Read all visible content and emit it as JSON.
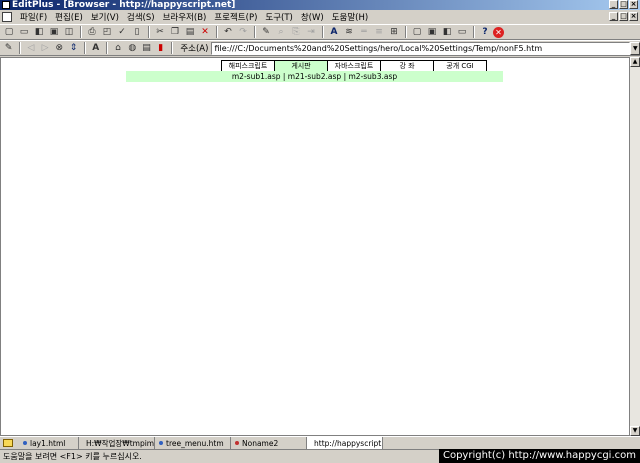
{
  "window": {
    "title": "EditPlus - [Browser - http://happyscript.net]",
    "buttons": {
      "minimize": "_",
      "maximize": "□",
      "close": "×"
    }
  },
  "menubar": {
    "items": [
      "파일(F)",
      "편집(E)",
      "보기(V)",
      "검색(S)",
      "브라우저(B)",
      "프로젝트(P)",
      "도구(T)",
      "창(W)",
      "도움말(H)"
    ]
  },
  "toolbar2": {
    "address_label": "주소(A)",
    "address_value": "file:///C:/Documents%20and%20Settings/hero/Local%20Settings/Temp/nonF5.htm"
  },
  "page": {
    "tabs": [
      {
        "label": "해피스크립트",
        "active": false
      },
      {
        "label": "게시판",
        "active": true
      },
      {
        "label": "자바스크립트",
        "active": false
      },
      {
        "label": "강  좌",
        "active": false
      },
      {
        "label": "공개 CGI",
        "active": false
      }
    ],
    "subnav": "m2-sub1.asp | m21-sub2.asp | m2-sub3.asp"
  },
  "doc_tabs": [
    {
      "label": "lay1.html",
      "active": false
    },
    {
      "label": "H:₩작업장₩tmpim",
      "active": false
    },
    {
      "label": "tree_menu.htm",
      "active": false
    },
    {
      "label": "Noname2",
      "active": false
    },
    {
      "label": "http://happyscript.",
      "active": true
    }
  ],
  "status": {
    "text": "도움말을 보려면 <F1> 키를 누르십시오.",
    "copyright": "Copyright(c) http://www.happycgi.com"
  },
  "colors": {
    "title_gradient_start": "#0a246a",
    "title_gradient_end": "#a6caf0",
    "tab_active_bg": "#ccffcc",
    "chrome": "#d4d0c8"
  }
}
